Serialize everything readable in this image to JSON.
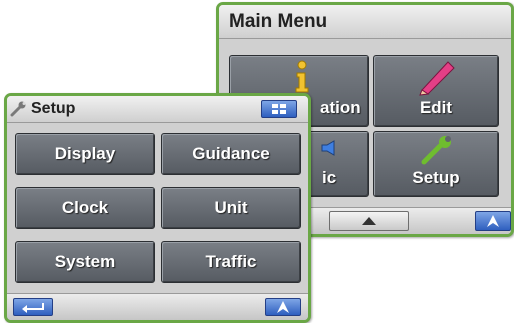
{
  "main_menu": {
    "title": "Main Menu",
    "buttons": {
      "information_partial": "ation",
      "edit": "Edit",
      "traffic_partial": "ic",
      "setup": "Setup"
    }
  },
  "setup": {
    "title": "Setup",
    "buttons": {
      "display": "Display",
      "guidance": "Guidance",
      "clock": "Clock",
      "unit": "Unit",
      "system": "System",
      "traffic": "Traffic"
    }
  },
  "icons": {
    "info": "info-icon",
    "pencil": "pencil-icon",
    "wrench": "wrench-icon",
    "speaker": "speaker-icon",
    "grid": "grid-icon",
    "up_arrow": "up-arrow-icon",
    "back": "back-arrow-icon",
    "navigation": "navigation-arrow-icon"
  },
  "colors": {
    "frame": "#6aa746",
    "button": "#5f646b",
    "blue_button": "#3f6fcc",
    "info": "#e6b800",
    "pencil": "#e0347a",
    "wrench": "#79c23a"
  }
}
